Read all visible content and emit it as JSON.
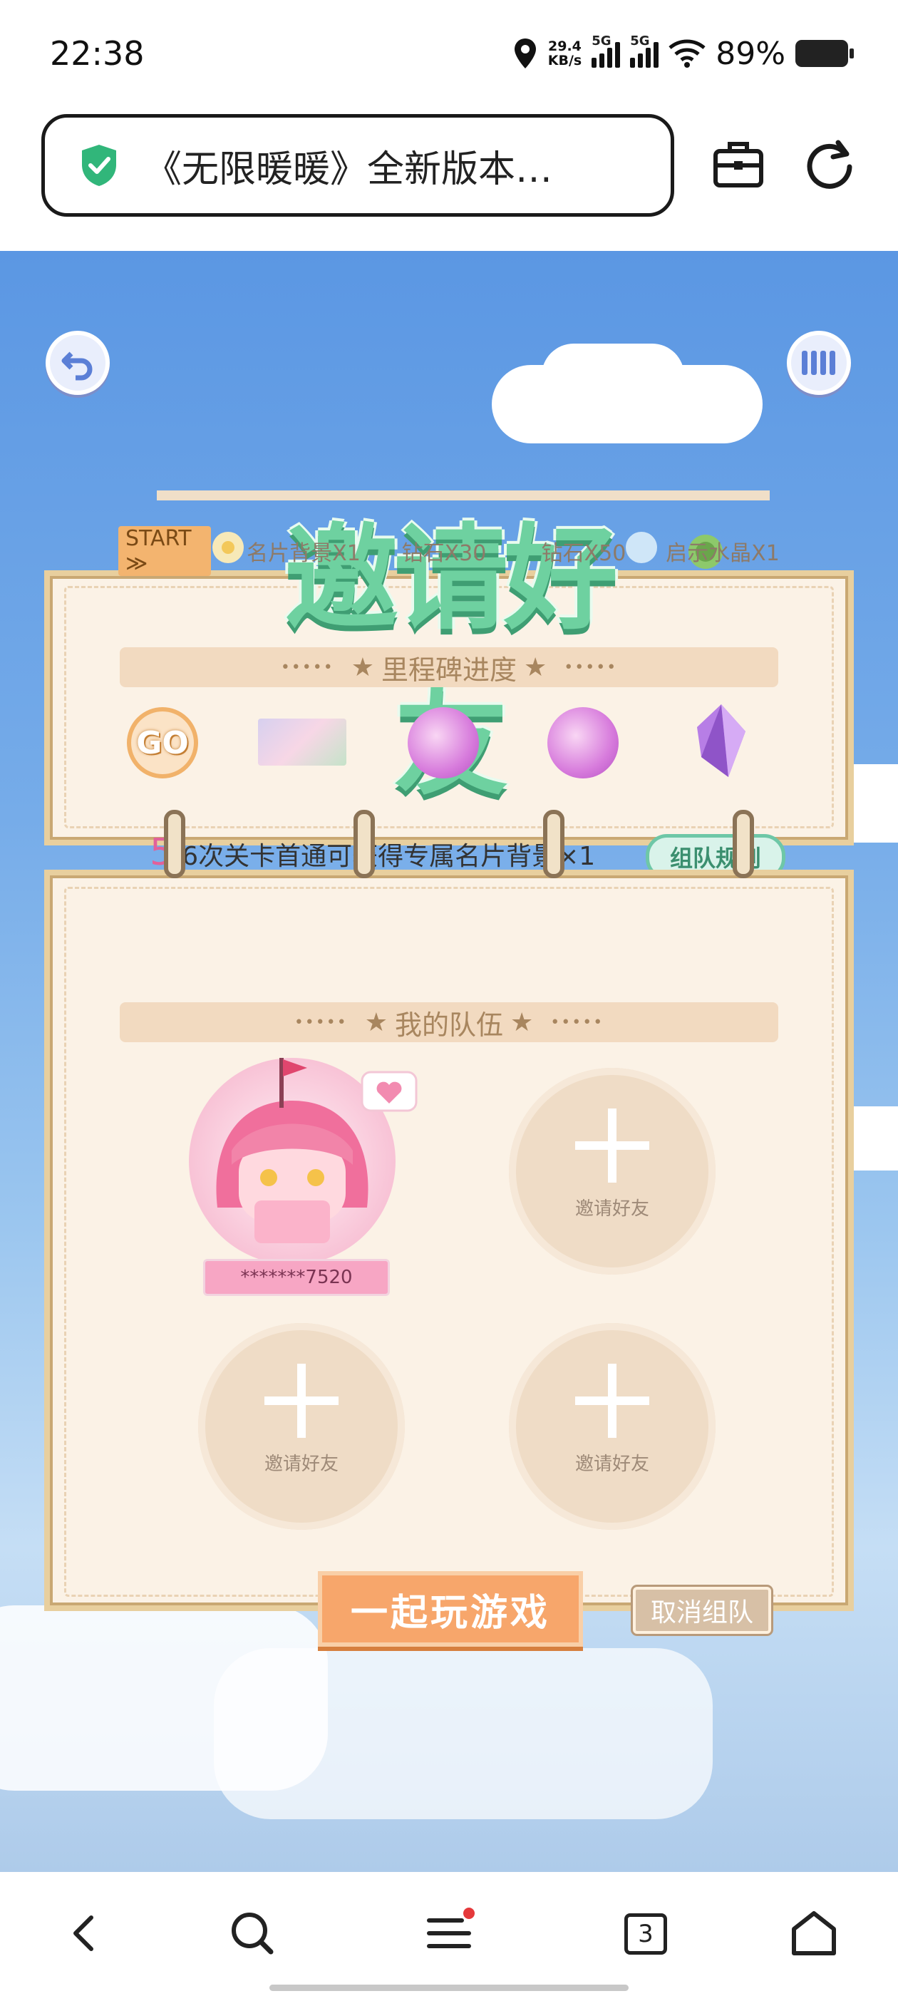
{
  "status_bar": {
    "time": "22:38",
    "net_speed_value": "29.4",
    "net_speed_unit": "KB/s",
    "sim1": "5G",
    "sim2": "5G",
    "battery_percent": "89%"
  },
  "browser": {
    "page_title": "《无限暖暖》全新版本…",
    "icons": [
      "shield-check-icon",
      "toolbox-icon",
      "refresh-icon"
    ]
  },
  "game": {
    "headline": "邀请好友",
    "milestone": {
      "header": "里程碑进度",
      "rewards": [
        {
          "label": "START ≫",
          "icon": "go-badge"
        },
        {
          "label": "名片背景X1",
          "icon": "card-background"
        },
        {
          "label": "钻石X30",
          "icon": "diamond"
        },
        {
          "label": "钻石X50",
          "icon": "diamond"
        },
        {
          "label": "启示水晶X1",
          "icon": "crystal"
        }
      ],
      "progress_current": "5",
      "progress_text": "/6次关卡首通可获得专属名片背景×1",
      "rules_button": "组队规则"
    },
    "team": {
      "header": "我的队伍",
      "member_name": "*******7520",
      "slot_label": "邀请好友",
      "slots": [
        "邀请好友",
        "邀请好友",
        "邀请好友"
      ]
    },
    "play_button": "一起玩游戏",
    "cancel_button": "取消组队"
  },
  "bottom_nav": {
    "tabs_count": "3",
    "items": [
      "back-icon",
      "search-icon",
      "menu-icon",
      "tabs-icon",
      "home-icon"
    ]
  }
}
